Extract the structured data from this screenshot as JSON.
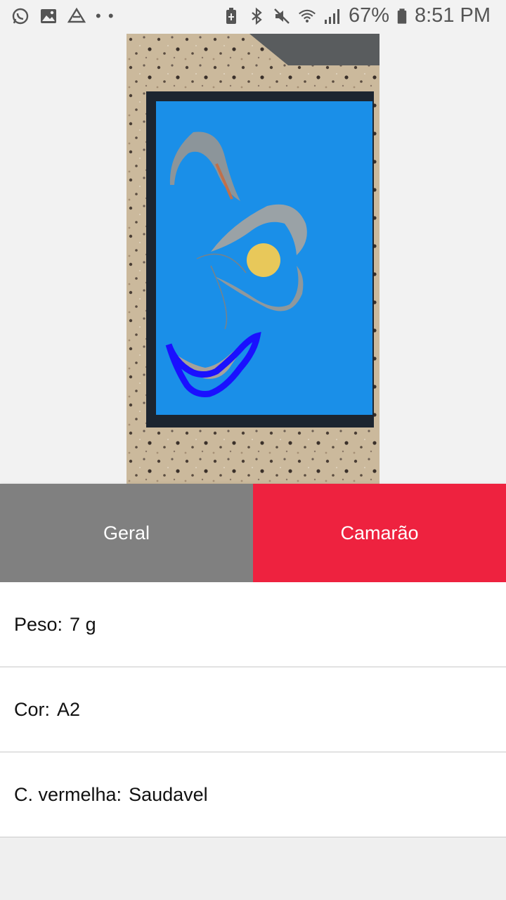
{
  "status_bar": {
    "left_icons": [
      "whatsapp-icon",
      "gallery-icon",
      "drive-icon",
      "more-dots-icon"
    ],
    "battery_percent": "67%",
    "time": "8:51 PM"
  },
  "photo": {
    "subject": "shrimp",
    "contour_color": "#1a10ff",
    "board_color": "#1a8fe8"
  },
  "tabs": [
    {
      "label": "Geral",
      "color": "#808080",
      "selected": false
    },
    {
      "label": "Camarão",
      "color": "#ee223f",
      "selected": true
    }
  ],
  "details": [
    {
      "label": "Peso:",
      "value": "7 g"
    },
    {
      "label": "Cor:",
      "value": "A2"
    },
    {
      "label": "C. vermelha:",
      "value": "Saudavel"
    }
  ]
}
